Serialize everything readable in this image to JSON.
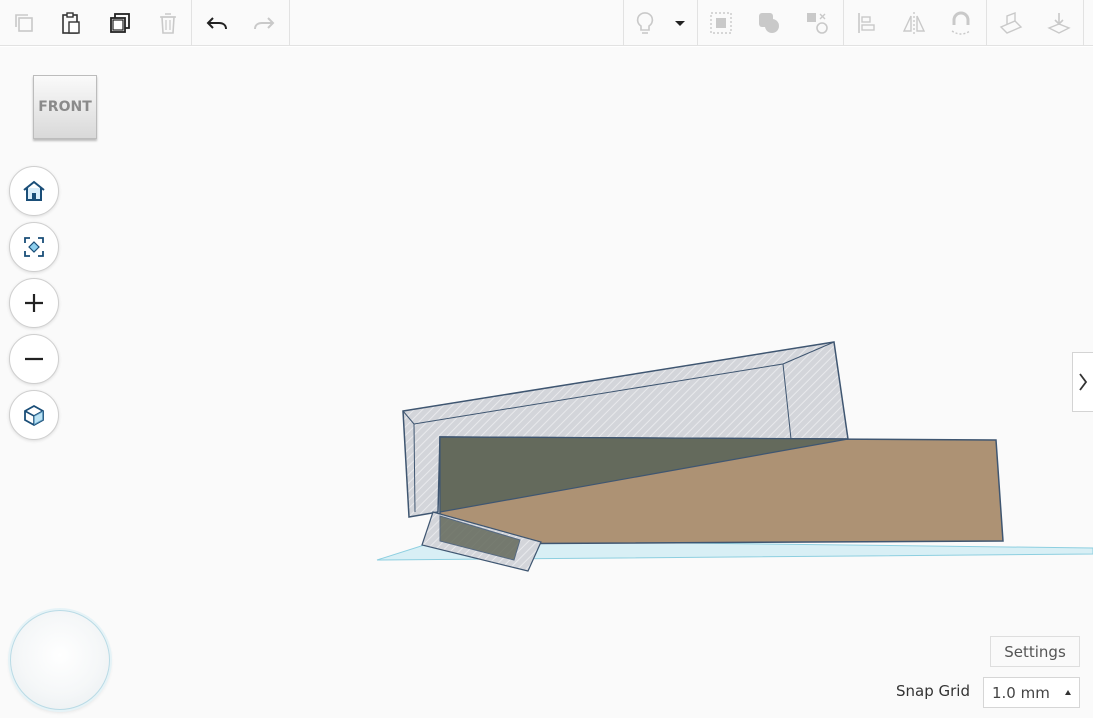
{
  "toolbar": {
    "buttons": [
      "copy",
      "paste",
      "duplicate",
      "delete",
      "undo",
      "redo",
      "show-all",
      "hide",
      "group",
      "ungroup",
      "align",
      "flip",
      "cruise",
      "workplane",
      "import"
    ]
  },
  "viewcube": {
    "face_label": "FRONT"
  },
  "settings": {
    "label": "Settings"
  },
  "snap_grid": {
    "label": "Snap Grid",
    "value": "1.0 mm"
  },
  "colors": {
    "accent": "#1a6aa0",
    "box_tan": "#ad9274",
    "box_dark": "#646a5c",
    "hole_gray": "#cfd1d6",
    "outline": "#3f5671",
    "workplane": "#d7eff5"
  }
}
